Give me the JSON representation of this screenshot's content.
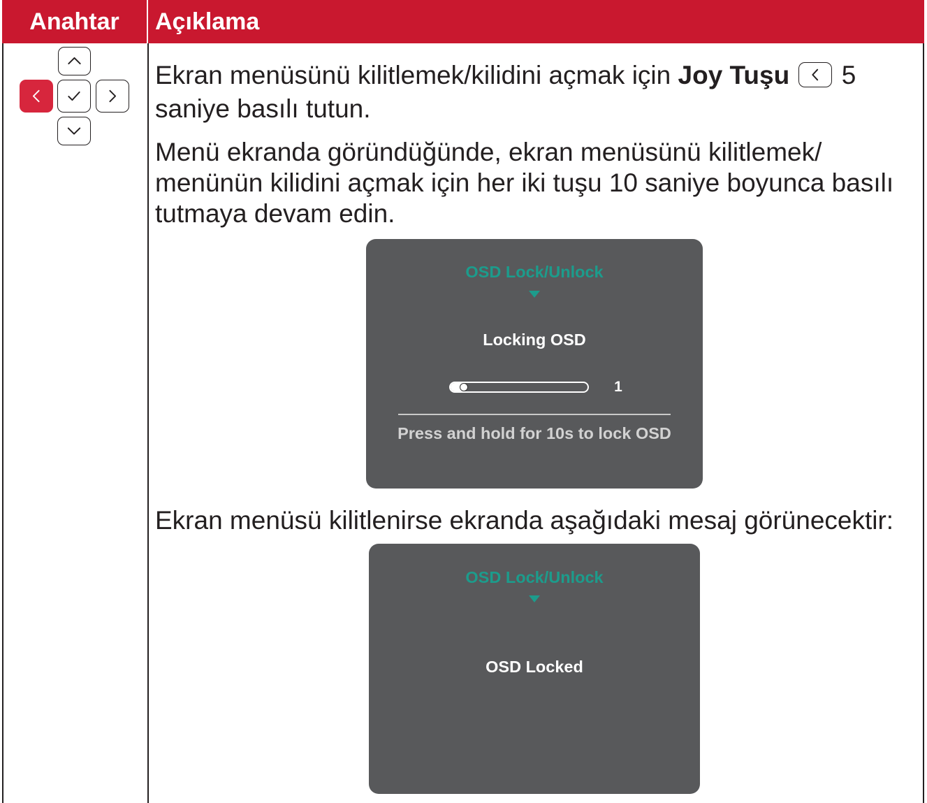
{
  "colors": {
    "header_red": "#c9182f",
    "key_highlight": "#d7263d",
    "osd_gray": "#58595b",
    "osd_teal": "#1c9c8c"
  },
  "table": {
    "headers": [
      "Anahtar",
      "Açıklama"
    ]
  },
  "joystick": {
    "buttons": [
      {
        "icon": "chevron-up-icon",
        "active": false
      },
      {
        "icon": "chevron-left-icon",
        "active": true
      },
      {
        "icon": "check-icon",
        "active": false
      },
      {
        "icon": "chevron-right-icon",
        "active": false
      },
      {
        "icon": "chevron-down-icon",
        "active": false
      }
    ]
  },
  "description": {
    "paragraph1": {
      "line1_text": "Ekran menüsünü kilitlemek/kilidini açmak için",
      "key_name": "Joy Tuşu",
      "key_icon": "chevron-left-icon",
      "hold_seconds": "5",
      "line2": "saniye basılı tutun."
    },
    "paragraph2": [
      "Menü ekranda göründüğünde, ekran menüsünü kilitlemek/",
      "menünün kilidini açmak için her iki tuşu 10 saniye boyunca basılı",
      "tutmaya devam edin."
    ],
    "paragraph3": "Ekran menüsü kilitlenirse ekranda aşağıdaki mesaj görünecektir:"
  },
  "osd_locking": {
    "title": "OSD Lock/Unlock",
    "status": "Locking OSD",
    "progress_value": "1",
    "progress_fraction": 0.1,
    "hint": "Press and hold for 10s to lock OSD"
  },
  "osd_locked": {
    "title": "OSD Lock/Unlock",
    "status": "OSD Locked"
  }
}
